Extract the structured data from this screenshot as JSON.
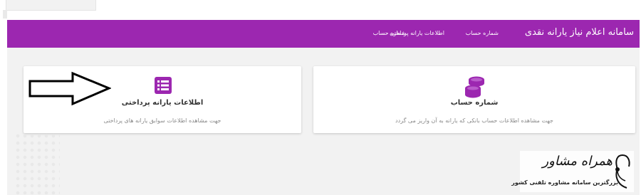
{
  "header": {
    "brand": "سامانه اعلام نیاز یارانه نقدی",
    "nav": [
      "شماره حساب",
      "اطلاعات یارانه پرداختی"
    ],
    "nav_extra": "شماره حساب"
  },
  "cards": [
    {
      "title": "اطلاعات یارانه پرداختی",
      "description": "جهت مشاهده اطلاعات سوابق یارانه های پرداختی",
      "icon": "list-icon"
    },
    {
      "title": "شماره حساب",
      "description": "جهت مشاهده اطلاعات حساب بانکی که یارانه به آن واریز می گردد",
      "icon": "coins-stack-icon"
    }
  ],
  "watermark": {
    "title": "همراه مشاور",
    "subtitle": "بزرگترین سامانه مشاوره تلفنی کشور"
  },
  "colors": {
    "header_bg": "#9c27b0",
    "accent": "#9c27b0",
    "content_bg": "#f2f2f2"
  }
}
